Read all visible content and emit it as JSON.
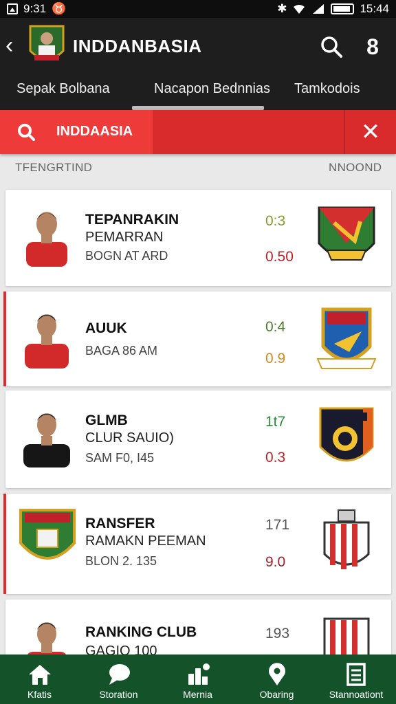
{
  "status": {
    "left_text": "9:31",
    "right_text": "15:44"
  },
  "header": {
    "title": "INDDANBASIA"
  },
  "tabs": [
    "Sepak Bolbana",
    "Nacapon Bednnias",
    "Tamkodois"
  ],
  "search": {
    "query": "INDDAASIA"
  },
  "columns": {
    "left": "TFENGRTIND",
    "right": "NNOOND"
  },
  "cards": [
    {
      "title": "TEPANRAKIN",
      "subtitle": "PEMARRAN",
      "meta": "BOGN AT ARD",
      "score_top": "0:3",
      "score_bottom": "0.50",
      "top_color": "#8a9a2a",
      "bottom_color": "#c0202a"
    },
    {
      "title": "AUUK",
      "subtitle": "",
      "meta": "BAGA 86 AM",
      "score_top": "0:4",
      "score_bottom": "0.9",
      "top_color": "#4a7a2a",
      "bottom_color": "#d08a20"
    },
    {
      "title": "GLMB",
      "subtitle": "CLUR SAUIO)",
      "meta": "SAM F0, I45",
      "score_top": "1t7",
      "score_bottom": "0.3",
      "top_color": "#2a8a3a",
      "bottom_color": "#c0202a"
    },
    {
      "title": "RANSFER",
      "subtitle": "RAMAKN PEEMAN",
      "meta": "BLON 2. 135",
      "score_top": "171",
      "score_bottom": "9.0",
      "top_color": "#555555",
      "bottom_color": "#a0202a"
    },
    {
      "title": "RANKING CLUB",
      "subtitle": "GAGIO 100",
      "meta": "",
      "score_top": "193",
      "score_bottom": "",
      "top_color": "#555555",
      "bottom_color": "#a0202a"
    }
  ],
  "nav": [
    {
      "label": "Kfatis",
      "icon": "home-icon"
    },
    {
      "label": "Storation",
      "icon": "chat-icon"
    },
    {
      "label": "Mernia",
      "icon": "stats-icon"
    },
    {
      "label": "Obaring",
      "icon": "location-icon"
    },
    {
      "label": "Stannoationt",
      "icon": "list-icon"
    }
  ],
  "colors": {
    "accent": "#e02b2b",
    "header": "#1e1e1e",
    "nav": "#14532a"
  }
}
